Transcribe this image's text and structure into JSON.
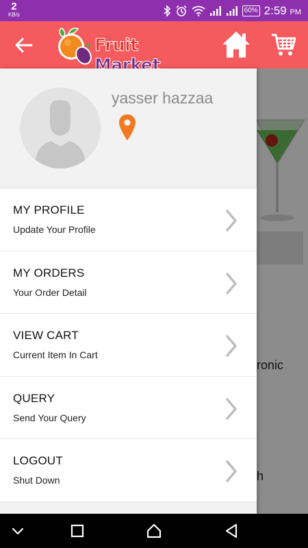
{
  "status_bar": {
    "net_speed_value": "2",
    "net_speed_unit": "KB/s",
    "battery": "60%",
    "time": "2:59",
    "ampm": "PM",
    "bg_color": "#8e2fae"
  },
  "app_bar": {
    "bg_color": "#f55a5e",
    "logo_word1": "Fruit",
    "logo_word2": "Market",
    "back_icon": "arrow-left-icon",
    "home_icon": "home-icon",
    "cart_icon": "shopping-cart-icon"
  },
  "drawer": {
    "user_name": "yasser hazzaa",
    "location_icon": "location-pin-icon",
    "accent_color": "#f07a24",
    "menu": [
      {
        "title": "MY PROFILE",
        "subtitle": "Update Your Profile"
      },
      {
        "title": "MY ORDERS",
        "subtitle": "Your Order Detail"
      },
      {
        "title": "VIEW CART",
        "subtitle": "Current Item In Cart"
      },
      {
        "title": "QUERY",
        "subtitle": "Send Your Query"
      },
      {
        "title": "LOGOUT",
        "subtitle": "Shut Down"
      }
    ]
  },
  "background": {
    "partial_text_1": "ronic",
    "partial_text_2": "h"
  },
  "nav_bar": {
    "buttons": [
      "chevron-down-icon",
      "recents-square-icon",
      "home-outline-icon",
      "back-triangle-icon"
    ]
  }
}
